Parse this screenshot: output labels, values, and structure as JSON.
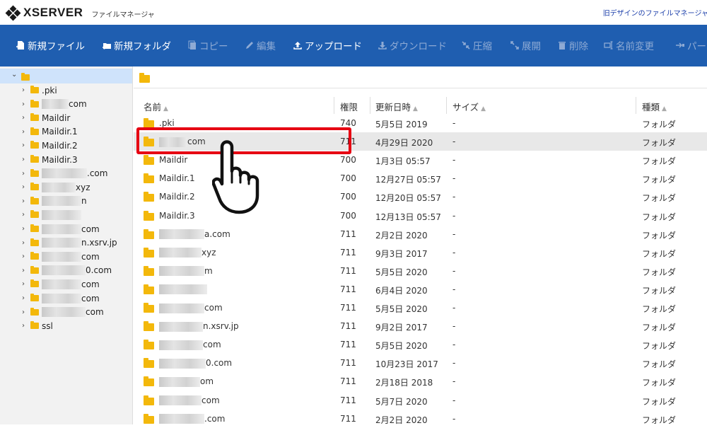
{
  "header": {
    "logo_text": "XSERVER",
    "app_name": "ファイルマネージャ",
    "old_design_link": "旧デザインのファイルマネージャ"
  },
  "toolbar": {
    "new_file": "新規ファイル",
    "new_folder": "新規フォルダ",
    "copy": "コピー",
    "edit": "編集",
    "upload": "アップロード",
    "download": "ダウンロード",
    "compress": "圧縮",
    "extract": "展開",
    "delete": "削除",
    "rename": "名前変更",
    "permission": "パー"
  },
  "tree": {
    "items": [
      {
        "label": ".pki"
      },
      {
        "label": "com"
      },
      {
        "label": "Maildir"
      },
      {
        "label": "Maildir.1"
      },
      {
        "label": "Maildir.2"
      },
      {
        "label": "Maildir.3"
      },
      {
        "label": ".com"
      },
      {
        "label": "xyz"
      },
      {
        "label": "n"
      },
      {
        "label": ""
      },
      {
        "label": "com"
      },
      {
        "label": "n.xsrv.jp"
      },
      {
        "label": "com"
      },
      {
        "label": "0.com"
      },
      {
        "label": "com"
      },
      {
        "label": "com"
      },
      {
        "label": "com"
      },
      {
        "label": "ssl"
      }
    ]
  },
  "table": {
    "headers": {
      "name": "名前",
      "perm": "権限",
      "date": "更新日時",
      "size": "サイズ",
      "type": "種類"
    },
    "rows": [
      {
        "name": ".pki",
        "perm": "740",
        "date": "5月5日 2019",
        "size": "-",
        "type": "フォルダ"
      },
      {
        "name": "com",
        "perm": "711",
        "date": "4月29日 2020",
        "size": "-",
        "type": "フォルダ"
      },
      {
        "name": "Maildir",
        "perm": "700",
        "date": "1月3日 05:57",
        "size": "-",
        "type": "フォルダ"
      },
      {
        "name": "Maildir.1",
        "perm": "700",
        "date": "12月27日 05:57",
        "size": "-",
        "type": "フォルダ"
      },
      {
        "name": "Maildir.2",
        "perm": "700",
        "date": "12月20日 05:57",
        "size": "-",
        "type": "フォルダ"
      },
      {
        "name": "Maildir.3",
        "perm": "700",
        "date": "12月13日 05:57",
        "size": "-",
        "type": "フォルダ"
      },
      {
        "name": "a.com",
        "perm": "711",
        "date": "2月2日 2020",
        "size": "-",
        "type": "フォルダ"
      },
      {
        "name": "xyz",
        "perm": "711",
        "date": "9月3日 2017",
        "size": "-",
        "type": "フォルダ"
      },
      {
        "name": "m",
        "perm": "711",
        "date": "5月5日 2020",
        "size": "-",
        "type": "フォルダ"
      },
      {
        "name": "",
        "perm": "711",
        "date": "6月4日 2020",
        "size": "-",
        "type": "フォルダ"
      },
      {
        "name": "com",
        "perm": "711",
        "date": "5月5日 2020",
        "size": "-",
        "type": "フォルダ"
      },
      {
        "name": "n.xsrv.jp",
        "perm": "711",
        "date": "9月2日 2017",
        "size": "-",
        "type": "フォルダ"
      },
      {
        "name": "com",
        "perm": "711",
        "date": "5月5日 2020",
        "size": "-",
        "type": "フォルダ"
      },
      {
        "name": "0.com",
        "perm": "711",
        "date": "10月23日 2017",
        "size": "-",
        "type": "フォルダ"
      },
      {
        "name": "om",
        "perm": "711",
        "date": "2月18日 2018",
        "size": "-",
        "type": "フォルダ"
      },
      {
        "name": "com",
        "perm": "711",
        "date": "5月7日 2020",
        "size": "-",
        "type": "フォルダ"
      },
      {
        "name": ".com",
        "perm": "711",
        "date": "2月2日 2020",
        "size": "-",
        "type": "フォルダ"
      }
    ]
  },
  "colors": {
    "toolbar": "#1f5eb0",
    "folder": "#f3b80b",
    "highlight": "#e60012",
    "selected_row": "#e8e8e8"
  }
}
